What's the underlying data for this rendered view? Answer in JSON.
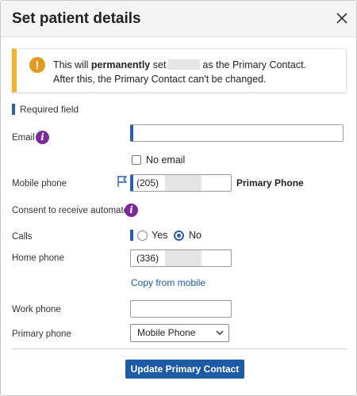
{
  "dialog": {
    "title": "Set patient details"
  },
  "banner": {
    "line1_prefix": "This will ",
    "line1_bold": "permanently",
    "line1_mid": " set",
    "line1_suffix": "as the Primary Contact.",
    "line2": "After this, the Primary Contact can't be changed."
  },
  "form": {
    "required_label": "Required field",
    "email_label": "Email",
    "email_value": "",
    "no_email_label": "No email",
    "mobile_label": "Mobile phone",
    "mobile_area": "(205)",
    "primary_phone_tag": "Primary Phone",
    "consent_label": "Consent to receive automated:",
    "calls_label": "Calls",
    "calls_yes": "Yes",
    "calls_no": "No",
    "home_label": "Home phone",
    "home_area": "(336)",
    "copy_link": "Copy from mobile",
    "work_label": "Work phone",
    "work_value": "",
    "primary_phone_label": "Primary phone",
    "primary_phone_selected": "Mobile Phone"
  },
  "actions": {
    "submit_label": "Update Primary Contact"
  },
  "colors": {
    "accent": "#1f5aa6",
    "warning": "#f3b52c",
    "info": "#7b2a9a"
  }
}
